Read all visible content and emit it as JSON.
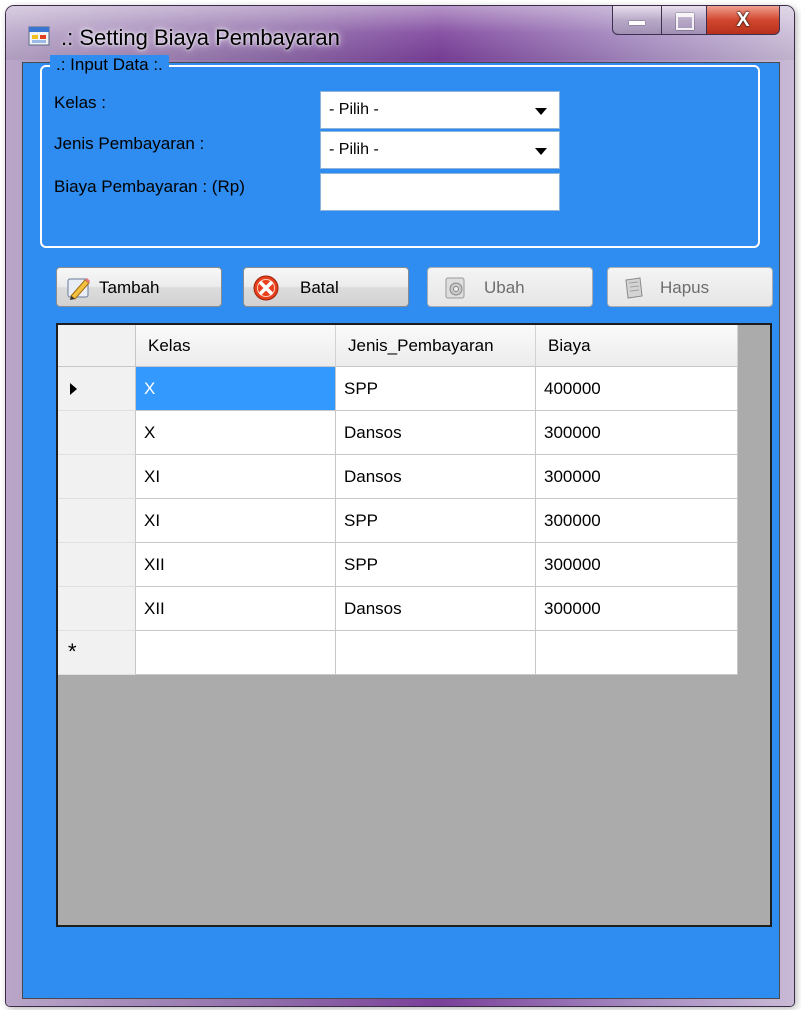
{
  "window": {
    "title": ".: Setting Biaya Pembayaran",
    "icon": "windows-form-icon"
  },
  "caption": {
    "minimize_icon": "minimize-icon",
    "maximize_icon": "maximize-icon",
    "close_glyph": "X"
  },
  "input_group": {
    "legend": ".: Input Data :.",
    "kelas_label": "Kelas :",
    "kelas_value": "- Pilih -",
    "jenis_label": "Jenis Pembayaran :",
    "jenis_value": "- Pilih -",
    "biaya_label": "Biaya Pembayaran : (Rp)",
    "biaya_value": ""
  },
  "buttons": {
    "tambah": {
      "label": "Tambah",
      "icon": "pencil-icon",
      "enabled": true
    },
    "batal": {
      "label": "Batal",
      "icon": "cancel-icon",
      "enabled": true
    },
    "ubah": {
      "label": "Ubah",
      "icon": "edit-icon",
      "enabled": false
    },
    "hapus": {
      "label": "Hapus",
      "icon": "delete-icon",
      "enabled": false
    }
  },
  "grid": {
    "columns": [
      "Kelas",
      "Jenis_Pembayaran",
      "Biaya"
    ],
    "rows": [
      {
        "kelas": "X",
        "jenis": "SPP",
        "biaya": "400000"
      },
      {
        "kelas": "X",
        "jenis": "Dansos",
        "biaya": "300000"
      },
      {
        "kelas": "XI",
        "jenis": "Dansos",
        "biaya": "300000"
      },
      {
        "kelas": "XI",
        "jenis": "SPP",
        "biaya": "300000"
      },
      {
        "kelas": "XII",
        "jenis": "SPP",
        "biaya": "300000"
      },
      {
        "kelas": "XII",
        "jenis": "Dansos",
        "biaya": "300000"
      }
    ],
    "current_row_marker": "current-row-arrow-icon",
    "new_row_marker": "*"
  },
  "colors": {
    "client_background": "#2f8cf0",
    "grid_background": "#ababab",
    "selection": "#3399ff"
  }
}
